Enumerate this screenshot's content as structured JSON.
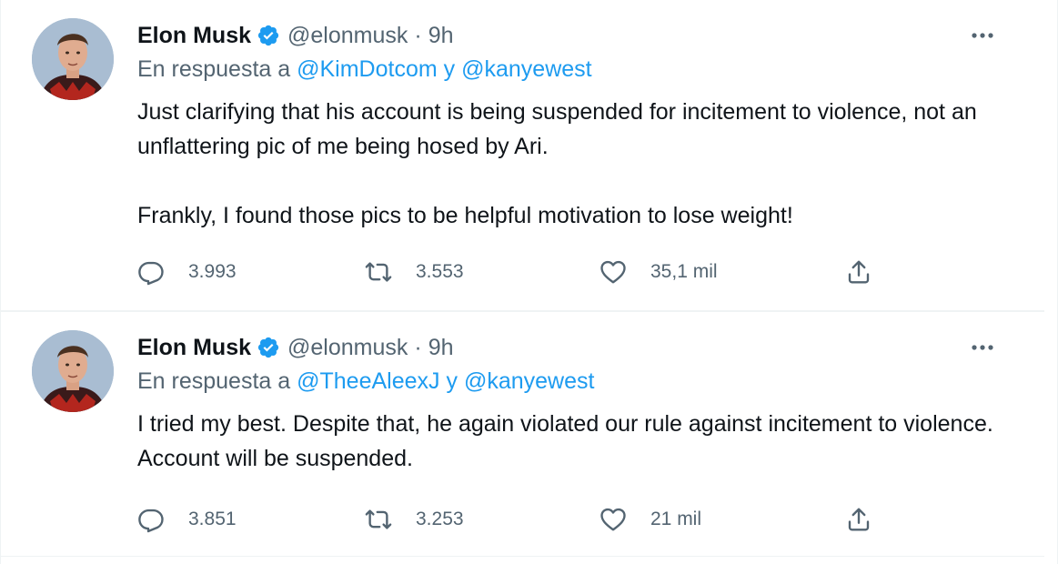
{
  "tweets": [
    {
      "author_name": "Elon Musk",
      "handle": "@elonmusk",
      "separator": "·",
      "time": "9h",
      "reply_prefix": "En respuesta a",
      "reply_mentions": [
        "@KimDotcom",
        "@kanyewest"
      ],
      "reply_joiner": "y",
      "paragraphs": [
        "Just clarifying that his account is being suspended for incitement to violence, not an unflattering pic of me being hosed by Ari.",
        "Frankly, I found those pics to be helpful motivation to lose weight!"
      ],
      "stats": {
        "replies": "3.993",
        "retweets": "3.553",
        "likes": "35,1 mil"
      }
    },
    {
      "author_name": "Elon Musk",
      "handle": "@elonmusk",
      "separator": "·",
      "time": "9h",
      "reply_prefix": "En respuesta a",
      "reply_mentions": [
        "@TheeAleexJ",
        "@kanyewest"
      ],
      "reply_joiner": "y",
      "paragraphs": [
        "I tried my best. Despite that, he again violated our rule against incitement to violence. Account will be suspended."
      ],
      "stats": {
        "replies": "3.851",
        "retweets": "3.253",
        "likes": "21 mil"
      }
    }
  ],
  "icons": {
    "verified": "verified-badge-icon",
    "more": "more-horizontal-icon",
    "reply": "reply-bubble-icon",
    "retweet": "retweet-icon",
    "like": "heart-icon",
    "share": "share-icon"
  },
  "colors": {
    "accent": "#1d9bf0",
    "secondary_text": "#536471",
    "primary_text": "#0f1419",
    "divider": "#eff3f4"
  }
}
